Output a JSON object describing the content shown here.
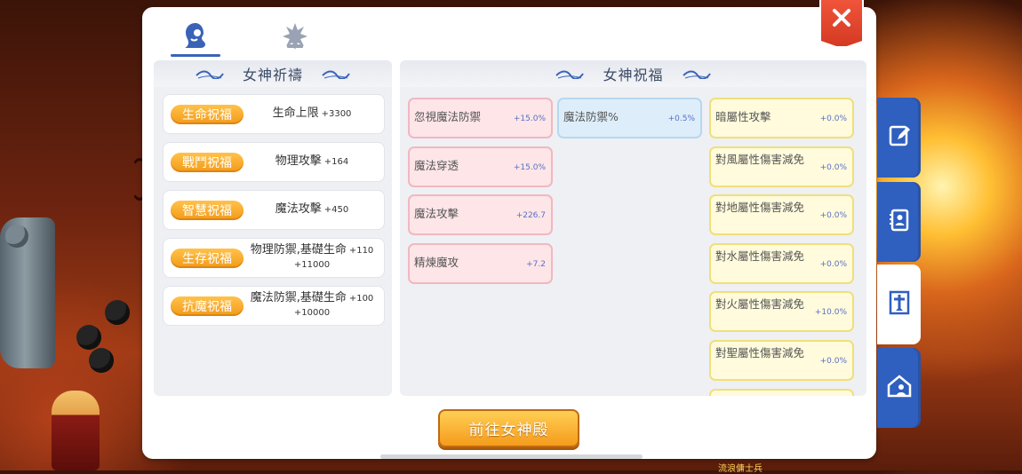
{
  "background": {
    "left_text": "",
    "right_text": "流浪傭士兵"
  },
  "top_tabs": [
    {
      "icon": "goddess-silhouette-icon",
      "active": true
    },
    {
      "icon": "snowflake-emblem-icon",
      "active": false
    }
  ],
  "prayer_section": {
    "title": "女神祈禱",
    "items": [
      {
        "badge": "生命祝福",
        "stat": "生命上限",
        "value": "+3300",
        "value2": ""
      },
      {
        "badge": "戰鬥祝福",
        "stat": "物理攻擊",
        "value": "+164",
        "value2": ""
      },
      {
        "badge": "智慧祝福",
        "stat": "魔法攻擊",
        "value": "+450",
        "value2": ""
      },
      {
        "badge": "生存祝福",
        "stat": "物理防禦,基礎生命",
        "value": "+110",
        "value2": "+11000"
      },
      {
        "badge": "抗魔祝福",
        "stat": "魔法防禦,基礎生命",
        "value": "+100",
        "value2": "+10000"
      }
    ]
  },
  "blessing_section": {
    "title": "女神祝福",
    "columns": [
      [
        {
          "name": "忽視魔法防禦",
          "value": "+15.0%",
          "color": "pink"
        },
        {
          "name": "魔法穿透",
          "value": "+15.0%",
          "color": "pink"
        },
        {
          "name": "魔法攻擊",
          "value": "+226.7",
          "color": "pink"
        },
        {
          "name": "精煉魔攻",
          "value": "+7.2",
          "color": "pink"
        }
      ],
      [
        {
          "name": "魔法防禦%",
          "value": "+0.5%",
          "color": "blue"
        }
      ],
      [
        {
          "name": "暗屬性攻擊",
          "value": "+0.0%",
          "color": "yellow"
        },
        {
          "name": "對風屬性傷害減免",
          "value": "+0.0%",
          "color": "yellow"
        },
        {
          "name": "對地屬性傷害減免",
          "value": "+0.0%",
          "color": "yellow"
        },
        {
          "name": "對水屬性傷害減免",
          "value": "+0.0%",
          "color": "yellow"
        },
        {
          "name": "對火屬性傷害減免",
          "value": "+10.0%",
          "color": "yellow"
        },
        {
          "name": "對聖屬性傷害減免",
          "value": "+0.0%",
          "color": "yellow"
        }
      ]
    ]
  },
  "bottom_button": {
    "label": "前往女神殿"
  },
  "side_tabs": [
    {
      "icon": "edit-note-icon",
      "active": false
    },
    {
      "icon": "contact-book-icon",
      "active": false
    },
    {
      "icon": "cross-banner-icon",
      "active": true
    },
    {
      "icon": "guild-house-icon",
      "active": false
    }
  ],
  "colors": {
    "accent_blue": "#2f5fbf",
    "badge_orange": "#f39a18",
    "close_red": "#e34a30",
    "value_blue": "#5a6fc4"
  }
}
